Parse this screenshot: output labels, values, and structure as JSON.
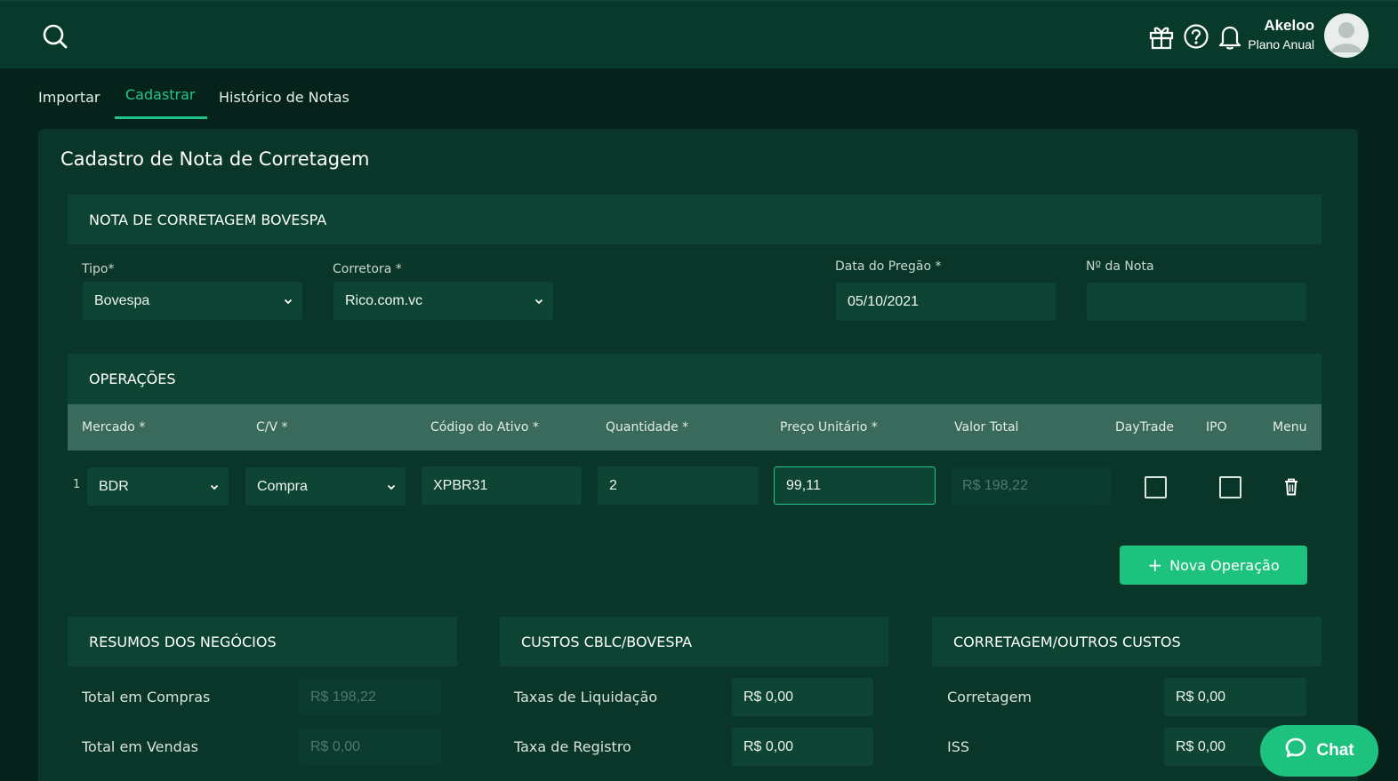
{
  "header": {
    "icons": [
      "search-icon",
      "gift-icon",
      "help-icon",
      "bell-icon"
    ],
    "user_name": "Akeloo",
    "user_plan": "Plano Anual"
  },
  "tabs": [
    {
      "label": "Importar",
      "active": false
    },
    {
      "label": "Cadastrar",
      "active": true
    },
    {
      "label": "Histórico de Notas",
      "active": false
    }
  ],
  "page_title": "Cadastro de Nota de Corretagem",
  "nota": {
    "section_title": "NOTA DE CORRETAGEM BOVESPA",
    "tipo_label": "Tipo*",
    "tipo_value": "Bovespa",
    "corretora_label": "Corretora *",
    "corretora_value": "Rico.com.vc",
    "data_label": "Data do Pregão *",
    "data_value": "05/10/2021",
    "numero_label": "Nº da Nota",
    "numero_value": ""
  },
  "operacoes": {
    "section_title": "OPERAÇÕES",
    "columns": [
      "Mercado *",
      "C/V *",
      "Código do Ativo *",
      "Quantidade *",
      "Preço Unitário *",
      "Valor Total",
      "DayTrade",
      "IPO",
      "Menu"
    ],
    "rows": [
      {
        "index": "1",
        "mercado": "BDR",
        "cv": "Compra",
        "codigo": "XPBR31",
        "quantidade": "2",
        "preco": "99,11",
        "valor_total": "R$ 198,22",
        "daytrade": false,
        "ipo": false
      }
    ],
    "add_button_label": "Nova Operação"
  },
  "resumo": {
    "section_title": "RESUMOS DOS NEGÓCIOS",
    "items": [
      {
        "label": "Total em Compras",
        "value": "R$ 198,22"
      },
      {
        "label": "Total em Vendas",
        "value": "R$ 0,00"
      }
    ]
  },
  "custos": {
    "section_title": "CUSTOS CBLC/BOVESPA",
    "items": [
      {
        "label": "Taxas de Liquidação",
        "value": "R$ 0,00"
      },
      {
        "label": "Taxa de Registro",
        "value": "R$ 0,00"
      }
    ]
  },
  "corretagem": {
    "section_title": "CORRETAGEM/OUTROS CUSTOS",
    "items": [
      {
        "label": "Corretagem",
        "value": "R$ 0,00"
      },
      {
        "label": "ISS",
        "value": "R$ 0,00"
      }
    ]
  },
  "chat_label": "Chat"
}
